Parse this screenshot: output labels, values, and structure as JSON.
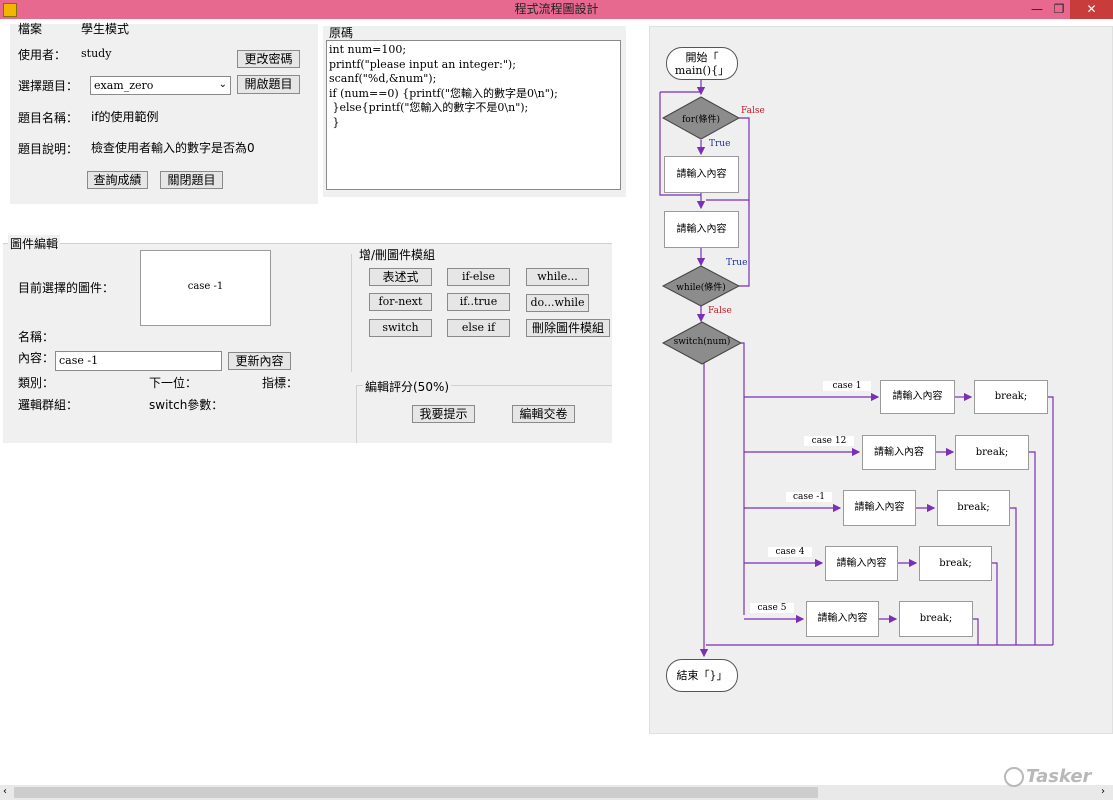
{
  "window": {
    "title": "程式流程圖設計",
    "minimize": "—",
    "maximize": "❐",
    "close": "✕"
  },
  "menu": {
    "file": "檔案",
    "mode": "學生模式"
  },
  "user": {
    "user_label": "使用者：",
    "user_value": "study",
    "change_password": "更改密碼",
    "select_label": "選擇題目：",
    "select_value": "exam_zero",
    "open_topic": "開啟題目",
    "name_label": "題目名稱：",
    "name_value": "if的使用範例",
    "desc_label": "題目說明：",
    "desc_value": "檢查使用者輸入的數字是否為0",
    "query_scores": "查詢成績",
    "close_topic": "關閉題目"
  },
  "source": {
    "title": "原碼",
    "lines": [
      "int num=100;",
      "printf(\"please input an integer:\");",
      "scanf(\"%d,&num\");",
      "if (num==0) {printf(\"您輸入的數字是0\\n\");",
      " }else{printf(\"您輸入的數字不是0\\n\");",
      " }"
    ]
  },
  "editor": {
    "title": "圖件編輯",
    "selected_label": "目前選擇的圖件：",
    "selected_preview": "case -1",
    "name_label": "名稱：",
    "content_label": "內容：",
    "content_value": "case -1",
    "update_button": "更新內容",
    "category_label": "類別：",
    "next_label": "下一位：",
    "pointer_label": "指標：",
    "logic_group_label": "邏輯群組：",
    "switch_param_label": "switch參數："
  },
  "modules": {
    "title": "增/刪圖件模組",
    "buttons": [
      "表述式",
      "if-else",
      "while...",
      "for-next",
      "if..true",
      "do...while",
      "switch",
      "else if",
      "刪除圖件模組"
    ]
  },
  "grading": {
    "title": "編輯評分(50%)",
    "hint": "我要提示",
    "submit": "編輯交卷"
  },
  "flowchart": {
    "start": [
      "開始「",
      "main(){」"
    ],
    "for_label": "for(條件)",
    "for_false": "False",
    "for_true": "True",
    "input": "請輸入內容",
    "while_label": "while(條件)",
    "while_true": "True",
    "while_false": "False",
    "switch_label": "switch(num)",
    "cases": [
      {
        "label": "case 1",
        "body": "請輸入內容",
        "break": "break;"
      },
      {
        "label": "case 12",
        "body": "請輸入內容",
        "break": "break;"
      },
      {
        "label": "case -1",
        "body": "請輸入內容",
        "break": "break;"
      },
      {
        "label": "case 4",
        "body": "請輸入內容",
        "break": "break;"
      },
      {
        "label": "case 5",
        "body": "請輸入內容",
        "break": "break;"
      }
    ],
    "end": "結束「}」",
    "colors": {
      "line": "#7b2fb5",
      "diamond": "#8c8c8c",
      "false": "#c0202a",
      "true": "#1f2f9a"
    }
  },
  "watermark": "Tasker"
}
